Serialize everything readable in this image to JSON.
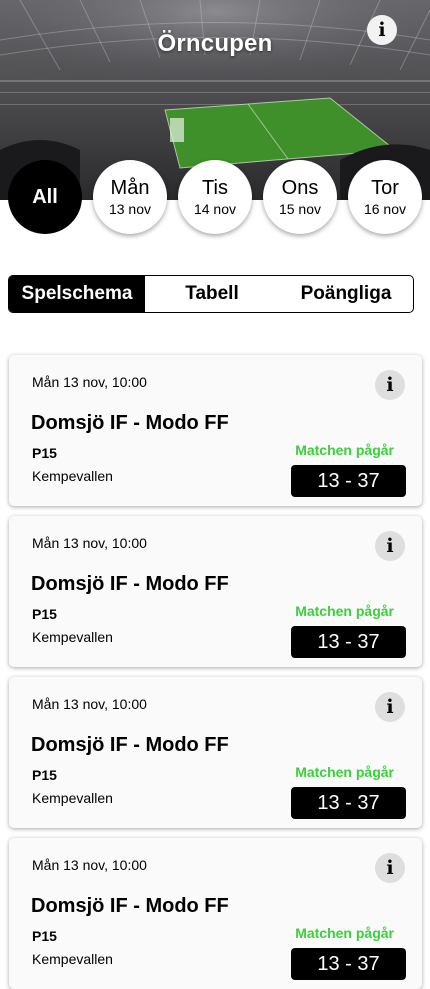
{
  "header": {
    "title": "Örncupen",
    "info_icon": "info-icon"
  },
  "days": [
    {
      "day": "All",
      "date": "",
      "active": true
    },
    {
      "day": "Mån",
      "date": "13 nov",
      "active": false
    },
    {
      "day": "Tis",
      "date": "14 nov",
      "active": false
    },
    {
      "day": "Ons",
      "date": "15 nov",
      "active": false
    },
    {
      "day": "Tor",
      "date": "16 nov",
      "active": false
    }
  ],
  "tabs": [
    {
      "label": "Spelschema",
      "active": true
    },
    {
      "label": "Tabell",
      "active": false
    },
    {
      "label": "Poängliga",
      "active": false
    }
  ],
  "matches": [
    {
      "when": "Mån 13 nov, 10:00",
      "teams": "Domsjö IF - Modo FF",
      "class": "P15",
      "venue": "Kempevallen",
      "status": "Matchen pågår",
      "score": "13 - 37"
    },
    {
      "when": "Mån 13 nov, 10:00",
      "teams": "Domsjö IF - Modo FF",
      "class": "P15",
      "venue": "Kempevallen",
      "status": "Matchen pågår",
      "score": "13 - 37"
    },
    {
      "when": "Mån 13 nov, 10:00",
      "teams": "Domsjö IF - Modo FF",
      "class": "P15",
      "venue": "Kempevallen",
      "status": "Matchen pågår",
      "score": "13 - 37"
    },
    {
      "when": "Mån 13 nov, 10:00",
      "teams": "Domsjö IF - Modo FF",
      "class": "P15",
      "venue": "Kempevallen",
      "status": "Matchen pågår",
      "score": "13 - 37"
    }
  ],
  "colors": {
    "status_live": "#3ccf3c",
    "pitch": "#3f8f2a",
    "accent": "#000000"
  },
  "info_glyph": "i"
}
